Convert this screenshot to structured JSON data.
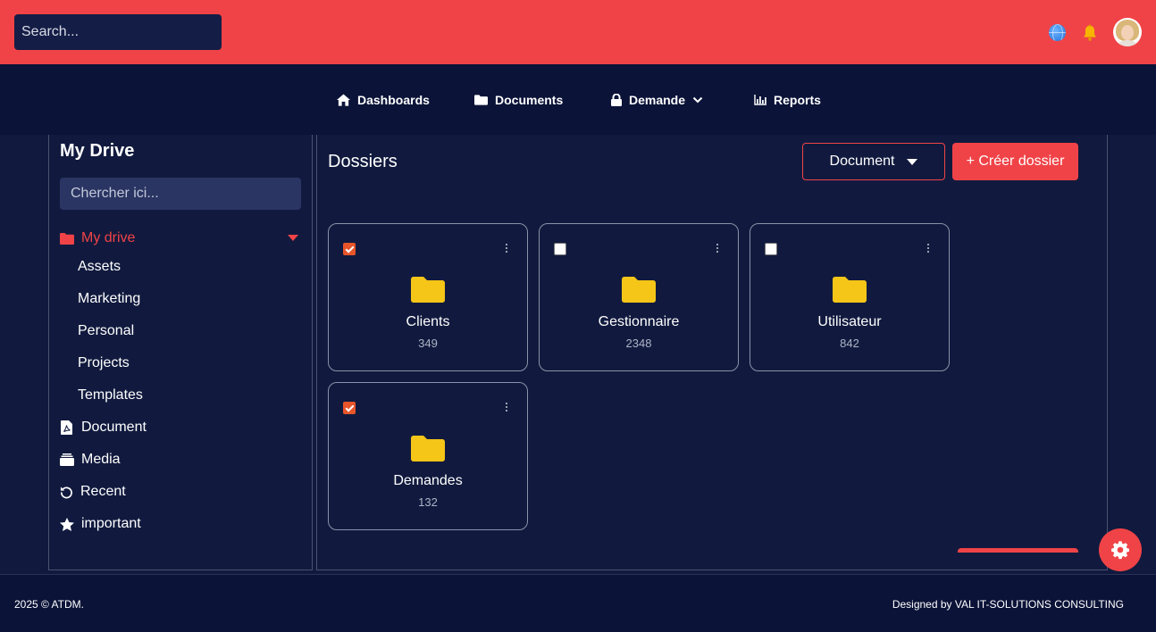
{
  "header": {
    "search_placeholder": "Search...",
    "icons": [
      "globe-icon",
      "bell-icon",
      "avatar"
    ]
  },
  "nav": {
    "items": [
      {
        "label": "Dashboards",
        "icon": "home-icon"
      },
      {
        "label": "Documents",
        "icon": "folder-icon"
      },
      {
        "label": "Demande",
        "icon": "lock-icon"
      },
      {
        "label": "Reports",
        "icon": "bar-chart-icon"
      }
    ]
  },
  "sidebar": {
    "title": "My Drive",
    "search_placeholder": "Chercher ici...",
    "active_item": {
      "label": "My drive",
      "icon": "folder-icon"
    },
    "subitems": [
      "Assets",
      "Marketing",
      "Personal",
      "Projects",
      "Templates"
    ],
    "items": [
      {
        "label": "Document",
        "icon": "file-pdf-icon"
      },
      {
        "label": "Media",
        "icon": "media-icon"
      },
      {
        "label": "Recent",
        "icon": "refresh-icon"
      },
      {
        "label": "important",
        "icon": "star-icon"
      }
    ]
  },
  "main": {
    "title": "Dossiers",
    "document_button": "Document",
    "create_button": "+ Créer dossier",
    "folders": [
      {
        "name": "Clients",
        "count": "349",
        "checked": true
      },
      {
        "name": "Gestionnaire",
        "count": "2348",
        "checked": false
      },
      {
        "name": "Utilisateur",
        "count": "842",
        "checked": false
      },
      {
        "name": "Demandes",
        "count": "132",
        "checked": true
      }
    ]
  },
  "footer": {
    "left": "2025 © ATDM.",
    "right": "Designed by VAL IT-SOLUTIONS CONSULTING"
  },
  "colors": {
    "accent": "#f04347",
    "background": "#111a3e",
    "nav": "#0b1338",
    "folder": "#f5c518"
  }
}
